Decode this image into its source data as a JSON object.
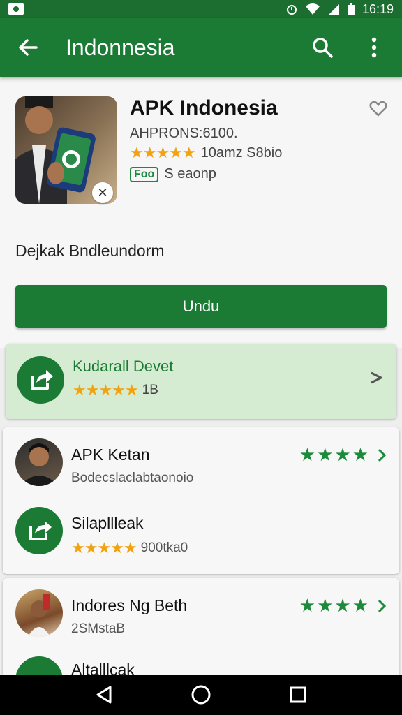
{
  "status_bar": {
    "time": "16:19"
  },
  "app_bar": {
    "title": "Indonnesia"
  },
  "app": {
    "name": "APK Indonesia",
    "developer": "AHPRONS:6100.",
    "review_text": "10amz S8bio",
    "free_badge": "Foo",
    "category": "S eaonp",
    "description": "Dejkak Bndleundorm",
    "download_label": "Undu",
    "rating_stars": "★★★★★"
  },
  "featured": {
    "title": "Kudarall Devet",
    "stars": "★★★★★",
    "count": "1B"
  },
  "list": [
    {
      "title": "APK Ketan",
      "subtitle": "Bodecslaclabtaonoio",
      "stars": "★★★★"
    },
    {
      "title": "Silapllleak",
      "stars": "★★★★★",
      "count": "900tka0"
    },
    {
      "title": "Indores Ng Beth",
      "subtitle": "2SMstaB",
      "stars": "★★★★"
    },
    {
      "title": "Altalllcak"
    }
  ],
  "colors": {
    "brand": "#1b7b34",
    "star": "#f2a20f",
    "featured_bg": "#d5ecd2"
  }
}
